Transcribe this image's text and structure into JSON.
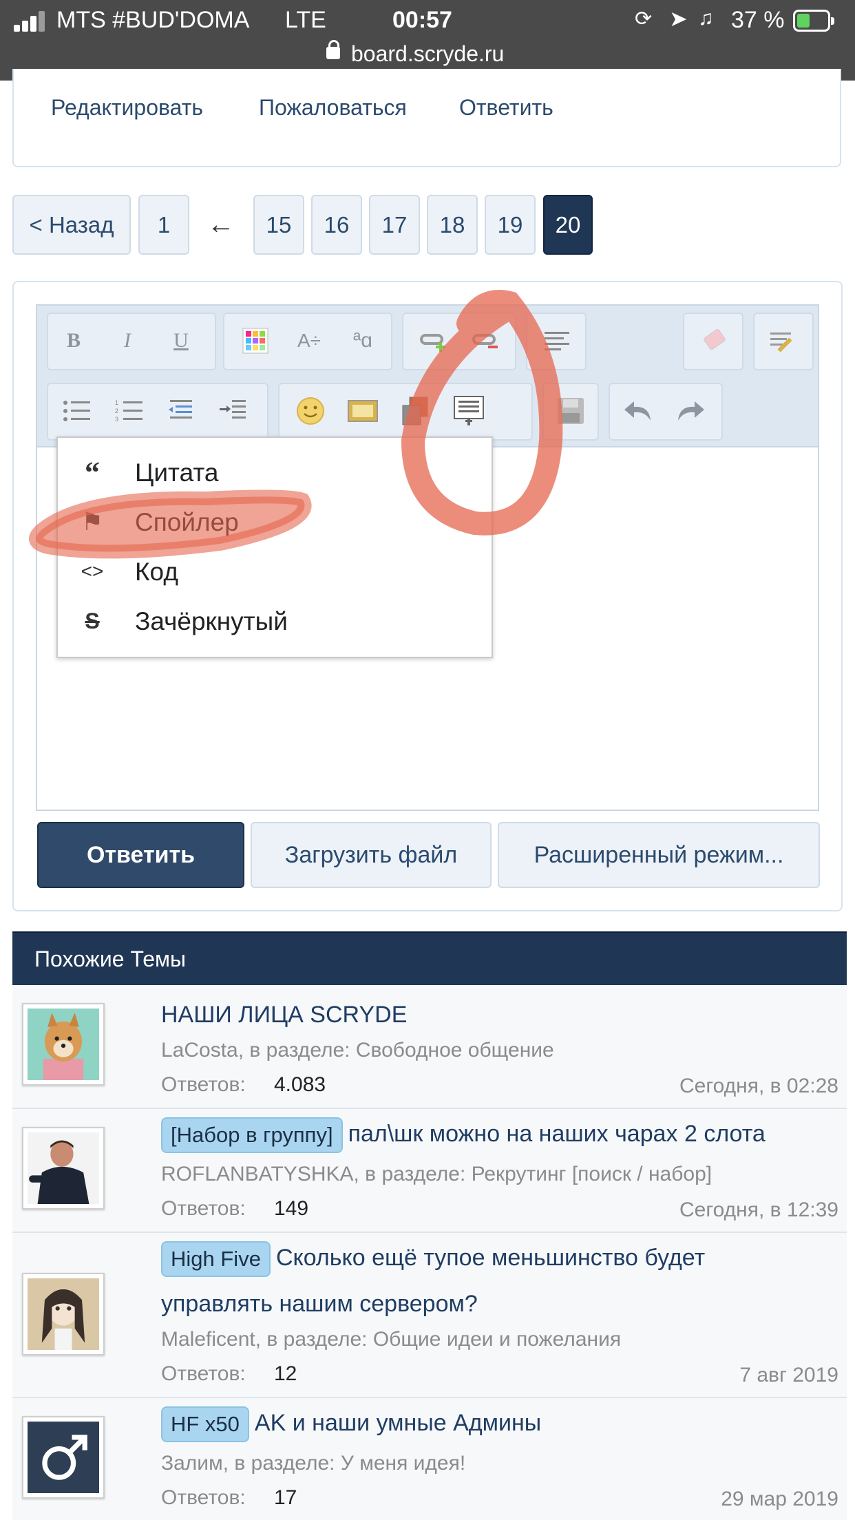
{
  "status_bar": {
    "carrier": "MTS #BUD'DOMA",
    "network": "LTE",
    "time": "00:57",
    "battery_percent": "37 %",
    "url": "board.scryde.ru"
  },
  "post_actions": {
    "edit": "Редактировать",
    "report": "Пожаловаться",
    "reply": "Ответить"
  },
  "pagination": {
    "prev": "< Назад",
    "first": "1",
    "arrow": "←",
    "pages": [
      "15",
      "16",
      "17",
      "18",
      "19"
    ],
    "current": "20"
  },
  "editor": {
    "toolbar_icons": [
      "bold-icon",
      "italic-icon",
      "underline-icon",
      "text-color-icon",
      "font-size-icon",
      "font-family-icon",
      "insert-link-icon",
      "remove-link-icon",
      "align-icon",
      "remove-format-icon",
      "toggle-editor-icon",
      "bullet-list-icon",
      "numbered-list-icon",
      "outdent-icon",
      "indent-icon",
      "smilies-icon",
      "insert-image-icon",
      "insert-media-icon",
      "insert-block-icon",
      "save-draft-icon",
      "undo-icon",
      "redo-icon"
    ],
    "bold": "B",
    "italic": "I",
    "underline": "U",
    "dropdown": [
      {
        "icon": "quote-icon",
        "glyph": "“",
        "label": "Цитата"
      },
      {
        "icon": "spoiler-flag-icon",
        "glyph": "⚑",
        "label": "Спойлер"
      },
      {
        "icon": "code-icon",
        "glyph": "<>",
        "label": "Код"
      },
      {
        "icon": "strikethrough-icon",
        "glyph": "S",
        "label": "Зачёркнутый"
      }
    ],
    "reply_button": "Ответить",
    "upload_button": "Загрузить файл",
    "advanced_button": "Расширенный режим..."
  },
  "similar_threads": {
    "title": "Похожие Темы",
    "replies_label": "Ответов:",
    "items": [
      {
        "prefix": "",
        "title": "НАШИ ЛИЦА SCRYDE",
        "title_line2": "",
        "meta": "LaCosta, в разделе: Свободное общение",
        "replies": "4.083",
        "date": "Сегодня, в 02:28"
      },
      {
        "prefix": "[Набор в группу]",
        "title": "пал\\шк можно на наших чарах 2 слота",
        "title_line2": "",
        "meta": "ROFLANBATYSHKA, в разделе: Рекрутинг [поиск / набор]",
        "replies": "149",
        "date": "Сегодня, в 12:39"
      },
      {
        "prefix": "High Five",
        "title": "Сколько ещё тупое меньшинство будет",
        "title_line2": "управлять нашим сервером?",
        "meta": "Maleficent, в разделе: Общие идеи и пожелания",
        "replies": "12",
        "date": "7 авг 2019"
      },
      {
        "prefix": "HF x50",
        "title": "AK и наши умные Админы",
        "title_line2": "",
        "meta": "Залим, в разделе: У меня идея!",
        "replies": "17",
        "date": "29 мар 2019"
      }
    ]
  },
  "colors": {
    "header_bg": "#1f3654",
    "link": "#1f3d63",
    "annotation": "#e5674f",
    "prefix_bg": "#a9d5f0"
  }
}
